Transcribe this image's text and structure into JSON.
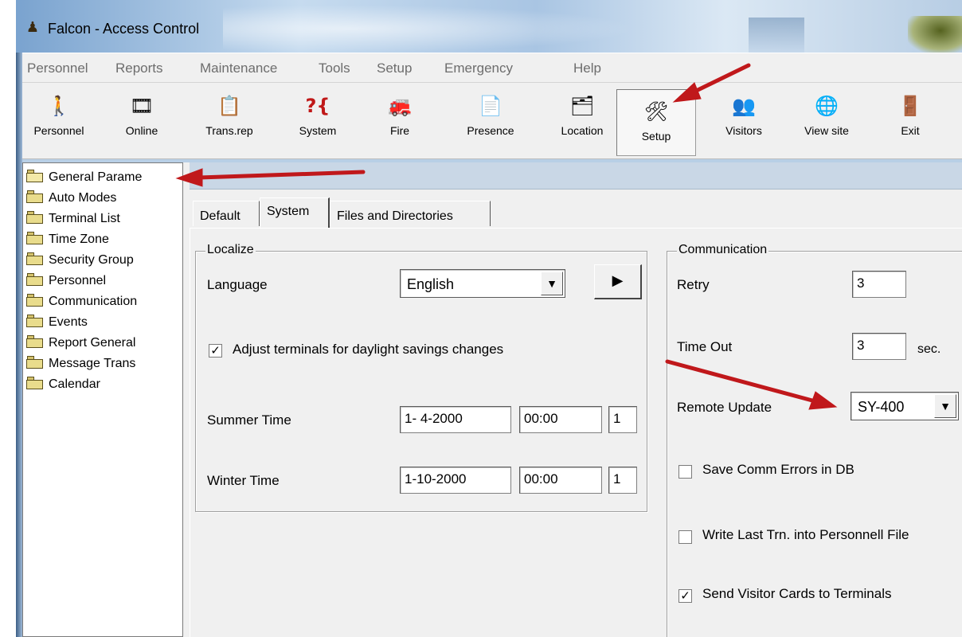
{
  "window": {
    "title": "Falcon - Access Control",
    "app_icon": "figure-icon"
  },
  "menu": [
    "Personnel",
    "Reports",
    "Maintenance",
    "Tools",
    "Setup",
    "Emergency",
    "Help"
  ],
  "toolbar": [
    {
      "label": "Personnel",
      "icon": "person-icon",
      "glyph": "🚶"
    },
    {
      "label": "Online",
      "icon": "film-icon",
      "glyph": "🎞"
    },
    {
      "label": "Trans.rep",
      "icon": "report-icon",
      "glyph": "📋"
    },
    {
      "label": "System",
      "icon": "question-icon",
      "glyph": "?{"
    },
    {
      "label": "Fire",
      "icon": "fire-truck-icon",
      "glyph": "🚒"
    },
    {
      "label": "Presence",
      "icon": "clipboard-icon",
      "glyph": "📄"
    },
    {
      "label": "Location",
      "icon": "tree-icon",
      "glyph": "🗂"
    },
    {
      "label": "Setup",
      "icon": "tools-icon",
      "glyph": "🛠"
    },
    {
      "label": "Visitors",
      "icon": "visitors-icon",
      "glyph": "👥"
    },
    {
      "label": "View site",
      "icon": "globe-icon",
      "glyph": "🌐"
    },
    {
      "label": "Exit",
      "icon": "door-icon",
      "glyph": "🚪"
    }
  ],
  "tree": [
    "General Parame",
    "Auto Modes",
    "Terminal List",
    "Time Zone",
    "Security Group",
    "Personnel",
    "Communication",
    "Events",
    "Report General",
    "Message Trans",
    "Calendar"
  ],
  "tabs": [
    "Default",
    "System",
    "Files and Directories"
  ],
  "localize": {
    "title": "Localize",
    "language_label": "Language",
    "language_value": "English",
    "dst_checkbox_label": "Adjust terminals for daylight savings changes",
    "summer_label": "Summer Time",
    "summer_date": "1- 4-2000",
    "summer_time": "00:00",
    "summer_num": "1",
    "winter_label": "Winter Time",
    "winter_date": "1-10-2000",
    "winter_time": "00:00",
    "winter_num": "1"
  },
  "communication": {
    "title": "Communication",
    "retry_label": "Retry",
    "retry_value": "3",
    "timeout_label": "Time Out",
    "timeout_value": "3",
    "timeout_unit": "sec.",
    "remote_label": "Remote Update",
    "remote_value": "SY-400",
    "save_errors_label": "Save Comm Errors in DB",
    "write_last_label": "Write Last Trn. into Personnell File",
    "send_visitor_label": "Send Visitor Cards to Terminals"
  },
  "colors": {
    "annotation_arrow": "#c0181b",
    "header_strip": "#c9d7e6"
  }
}
